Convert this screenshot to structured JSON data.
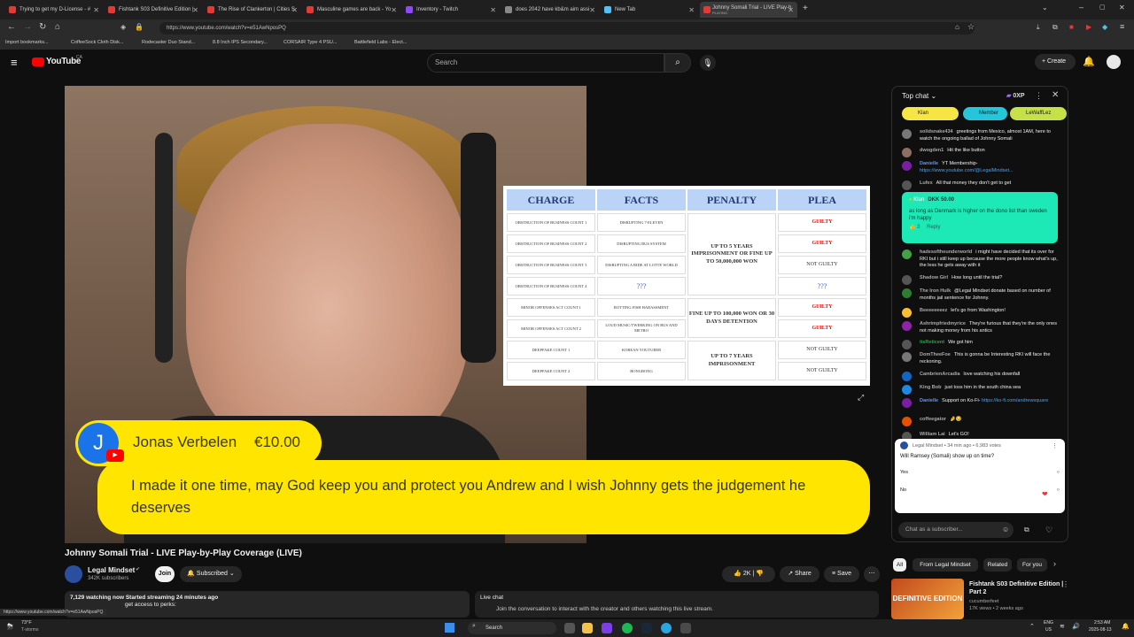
{
  "browser": {
    "tabs": [
      {
        "label": "Trying to get my D-License - #"
      },
      {
        "label": "Fishtank S03 Definitive Edition |"
      },
      {
        "label": "The Rise of Clankerton | Cities S"
      },
      {
        "label": "Masculine games are back - Yo"
      },
      {
        "label": "Inventory - Twitch"
      },
      {
        "label": "does 2042 have kb&m aim assi"
      },
      {
        "label": "New Tab"
      },
      {
        "label": "Johnny Somali Trial - LIVE Play-b",
        "sub": "PLAYING"
      }
    ],
    "url": "https://www.youtube.com/watch?v=e51AwNposPQ",
    "bookmarks": [
      "Import bookmarks...",
      "CoffeeSock Cloth Disk...",
      "Rodecaster Duo Stand...",
      "8.8 Inch IPS Secondary...",
      "CORSAIR Type 4 PSU...",
      "Battlefield Labs - Elect..."
    ]
  },
  "youtube": {
    "logo": "YouTube",
    "region": "CA",
    "search_placeholder": "Search",
    "create_label": "Create"
  },
  "overlay_table": {
    "headers": [
      "CHARGE",
      "FACTS",
      "PENALTY",
      "PLEA"
    ],
    "rows": [
      {
        "charge": "OBSTRUCTION OF BUSINESS COUNT 1",
        "facts": "DISRUPTING 7-ELEVEN",
        "plea": "GUILTY"
      },
      {
        "charge": "OBSTRUCTION OF BUSINESS COUNT 2",
        "facts": "DISRUPTING BUS SYSTEM",
        "plea": "GUILTY"
      },
      {
        "charge": "OBSTRUCTION OF BUSINESS COUNT 3",
        "facts": "DISRUPTING A RIDE AT LOTTE WORLD",
        "plea": "NOT GUILTY"
      },
      {
        "charge": "OBSTRUCTION OF BUSINESS COUNT 4",
        "facts": "???",
        "plea": "???"
      },
      {
        "charge": "MINOR OFFENSES ACT COUNT 1",
        "facts": "ROTTING FISH HARASSMENT",
        "plea": "GUILTY"
      },
      {
        "charge": "MINOR OFFENSES ACT COUNT 2",
        "facts": "LOUD MUSIC/TWERKING ON BUS AND METRO",
        "plea": "GUILTY"
      },
      {
        "charge": "DEEPFAKE COUNT 1",
        "facts": "KOREAN YOUTUBER",
        "plea": "NOT GUILTY"
      },
      {
        "charge": "DEEPFAKE COUNT 2",
        "facts": "BONGBONG",
        "plea": "NOT GUILTY"
      }
    ],
    "penalties": [
      "UP TO 5 YEARS IMPRISONMENT OR FINE UP TO 50,000,000 WON",
      "FINE UP TO 100,000 WON OR 30 DAYS DETENTION",
      "UP TO 7 YEARS IMPRISONMENT"
    ]
  },
  "donation": {
    "initial": "J",
    "name": "Jonas Verbelen",
    "amount": "€10.00",
    "message": "I made it one time, may God keep you and protect you Andrew and I wish Johnny gets the judgement he deserves"
  },
  "video_info": {
    "title": "Johnny Somali Trial - LIVE Play-by-Play Coverage (LIVE)",
    "channel": "Legal Mindset",
    "subscribers": "342K subscribers",
    "join": "Join",
    "subscribed": "Subscribed",
    "likes": "2K",
    "share": "Share",
    "save": "Save",
    "watching": "7,129 watching now  Started streaming 24 minutes ago",
    "desc_line": "get access to perks:",
    "livechat_title": "Live chat",
    "livechat_text": "Join the conversation to interact with the creator and others watching this live stream."
  },
  "chat": {
    "header": "Top chat",
    "xp": "0XP",
    "chips": [
      "Klan",
      "Member",
      "LeWaffLez"
    ],
    "messages": [
      {
        "author": "solidsnake434",
        "text": "greetings from Mexico, almost 1AM, here to watch the ongoing ballad of Johnny Somali",
        "color": "#777"
      },
      {
        "author": "dwogden1",
        "text": "Hit the like button",
        "color": "#8d6e63"
      },
      {
        "author": "Danielle",
        "text": "YT Membership-",
        "link": "https://www.youtube.com/@LegalMindset...",
        "color": "#7b1fa2"
      },
      {
        "author": "Lufex",
        "text": "All that money they don't get to get",
        "color": "#555"
      },
      {
        "author": "hadesoftheunderworld",
        "text": "i might have decided that its over for RKI but i still keep up because the more people know what's up, the less he gets away with it",
        "color": "#43a047"
      },
      {
        "author": "Shadow Girl",
        "text": "How long until the trial?",
        "color": "#555"
      },
      {
        "author": "The Iron Hulk",
        "text": "@Legal Mindset donate based on number of months jail sentence for Johnny.",
        "color": "#2e7d32"
      },
      {
        "author": "Beeeeeeeez",
        "text": "let's go from Washington!",
        "color": "#fbc02d"
      },
      {
        "author": "Ashrimpfriedmyrice",
        "text": "They're furious that they're the only ones not making money from his antics",
        "color": "#8e24aa"
      },
      {
        "author": "itsReticent",
        "text": "We got him",
        "color": "#555"
      },
      {
        "author": "DomTheeFoe",
        "text": "This is gonna be Interesting RKI will face the reckoning.",
        "color": "#777"
      },
      {
        "author": "CambrienArcadia",
        "text": "love watching his downfall",
        "color": "#1565c0"
      },
      {
        "author": "King Bob",
        "text": "just toss him in the south china sea",
        "color": "#1e88e5"
      },
      {
        "author": "Danielle",
        "text": "Support on Ko-Fi-",
        "link": "https://ko-fi.com/andrewsquare",
        "color": "#7b1fa2"
      },
      {
        "author": "coffeegator",
        "text": "🤌😏",
        "color": "#e65100"
      },
      {
        "author": "William Lai",
        "text": "Let's GO!",
        "color": "#555"
      }
    ],
    "superchat": {
      "author": "Klan",
      "amount": "DKK 50.00",
      "text": "as long as Denmark is higher on the dono list than sweden i'm happy",
      "likes": "3",
      "reply": "Reply"
    },
    "poll": {
      "meta": "Legal Mindset • 34 min ago • 6,983 votes",
      "question": "Will Ramsey (Somali) show up on time?",
      "options": [
        "Yes",
        "No"
      ]
    },
    "input_placeholder": "Chat as a subscriber..."
  },
  "recommendations": {
    "filters": [
      "All",
      "From Legal Mindset",
      "Related",
      "For you"
    ],
    "item": {
      "title": "Fishtank S03 Definitive Edition | Part 2",
      "channel": "cucumberfeet",
      "meta": "17K views • 2 weeks ago",
      "thumb_text": "DEFINITIVE EDITION"
    }
  },
  "taskbar": {
    "weather": "73°F",
    "weather_sub": "T-storms",
    "search": "Search",
    "lang": "ENG",
    "region": "US",
    "time": "2:53 AM",
    "date": "2025-08-13"
  },
  "status_url": "https://www.youtube.com/watch?v=e51AwNposPQ"
}
